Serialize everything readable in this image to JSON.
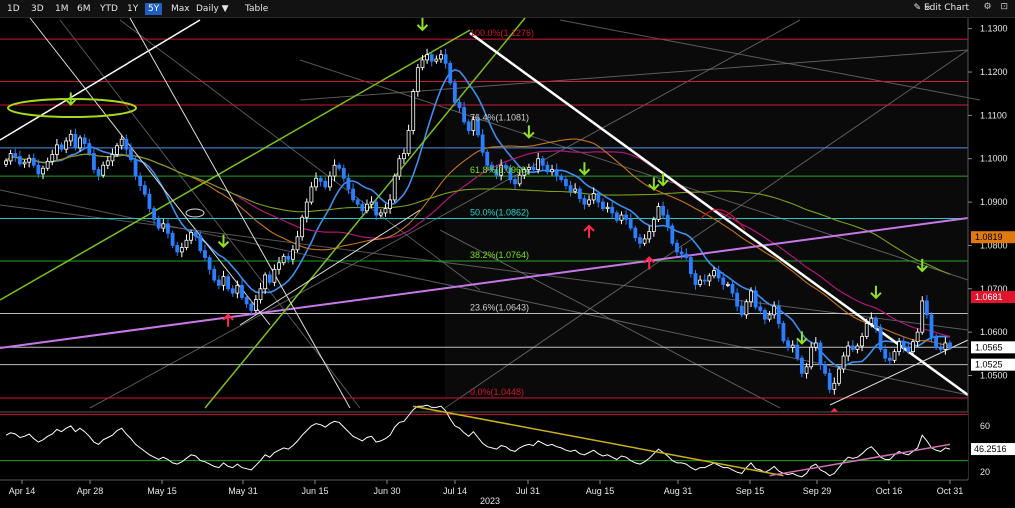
{
  "toolbar": {
    "ranges": [
      "1D",
      "3D",
      "1M",
      "6M",
      "YTD",
      "1Y",
      "5Y",
      "Max"
    ],
    "active_range": "5Y",
    "period": "Daily ▼",
    "table": "Table",
    "edit_chart": "✎ Edit Chart",
    "collapse_icon": "«",
    "icons": "⚙ ⊡"
  },
  "chart_data": {
    "type": "candlestick",
    "year_label": "2023",
    "x_ticks": [
      "Apr 14",
      "Apr 28",
      "May 15",
      "May 31",
      "Jun 15",
      "Jun 30",
      "Jul 14",
      "Jul 31",
      "Aug 15",
      "Aug 31",
      "Sep 15",
      "Sep 29",
      "Oct 16",
      "Oct 31"
    ],
    "y_ticks": [
      "1.1300",
      "1.1200",
      "1.1100",
      "1.1000",
      "1.0900",
      "1.0800",
      "1.0700",
      "1.0600",
      "1.0500"
    ],
    "ylim": [
      1.0425,
      1.132
    ],
    "close_series": [
      1.0995,
      1.1012,
      1.1005,
      1.0988,
      1.0992,
      1.1001,
      1.0985,
      1.0965,
      1.0978,
      1.0994,
      1.101,
      1.1032,
      1.1022,
      1.1041,
      1.1056,
      1.1025,
      1.1048,
      1.1035,
      1.1012,
      1.0975,
      1.0962,
      1.0985,
      1.0995,
      1.101,
      1.103,
      1.1045,
      1.1022,
      1.0998,
      1.096,
      1.0938,
      1.0918,
      1.0885,
      1.086,
      1.084,
      1.085,
      1.0828,
      1.08,
      1.0785,
      1.0795,
      1.0812,
      1.083,
      1.0822,
      1.0788,
      1.0772,
      1.0745,
      1.072,
      1.0708,
      1.0728,
      1.07,
      1.069,
      1.0708,
      1.068,
      1.0665,
      1.065,
      1.0675,
      1.07,
      1.0732,
      1.0715,
      1.0745,
      1.076,
      1.0775,
      1.0768,
      1.079,
      1.082,
      1.0865,
      1.09,
      1.0935,
      1.0955,
      1.0948,
      1.0935,
      1.096,
      1.0985,
      1.0978,
      1.0955,
      1.093,
      1.0905,
      1.0895,
      1.088,
      1.0895,
      1.09,
      1.087,
      1.0875,
      1.0885,
      1.0905,
      1.096,
      1.1,
      1.1012,
      1.1065,
      1.1155,
      1.121,
      1.1228,
      1.124,
      1.1225,
      1.123,
      1.124,
      1.122,
      1.1175,
      1.113,
      1.1118,
      1.1085,
      1.1065,
      1.109,
      1.1055,
      1.1015,
      1.0985,
      1.0975,
      1.0962,
      1.0985,
      1.0978,
      1.0952,
      1.0942,
      1.0962,
      1.0975,
      1.098,
      1.0975,
      1.1,
      1.0985,
      1.097,
      1.0975,
      1.096,
      1.0952,
      1.0938,
      1.0925,
      1.093,
      1.0908,
      1.0895,
      1.0905,
      1.092,
      1.09,
      1.0885,
      1.0888,
      1.0875,
      1.0858,
      1.087,
      1.086,
      1.084,
      1.0818,
      1.0805,
      1.0815,
      1.0832,
      1.086,
      1.089,
      1.087,
      1.0845,
      1.0805,
      1.0785,
      1.078,
      1.0772,
      1.0735,
      1.071,
      1.072,
      1.0718,
      1.073,
      1.0742,
      1.0725,
      1.071,
      1.071,
      1.069,
      1.066,
      1.064,
      1.067,
      1.0695,
      1.0658,
      1.065,
      1.063,
      1.064,
      1.066,
      1.062,
      1.058,
      1.0565,
      1.057,
      1.054,
      1.0505,
      1.052,
      1.0565,
      1.0575,
      1.0525,
      1.0505,
      1.0468,
      1.0482,
      1.0515,
      1.0545,
      1.0568,
      1.056,
      1.0568,
      1.059,
      1.062,
      1.0632,
      1.061,
      1.056,
      1.054,
      1.0535,
      1.0555,
      1.0578,
      1.0565,
      1.0555,
      1.0578,
      1.06,
      1.0672,
      1.064,
      1.0588,
      1.0565,
      1.056,
      1.0575,
      1.0565
    ],
    "last_price": "1.0565",
    "price_labels": [
      "1.0819",
      "1.0681",
      "1.0565",
      "1.0525"
    ],
    "fib_levels": [
      {
        "label": "100.0%(1.1276)",
        "value": 1.1276
      },
      {
        "label": "76.4%(1.1081)",
        "value": 1.1081
      },
      {
        "label": "61.8%(1.0960)",
        "value": 1.096
      },
      {
        "label": "50.0%(1.0862)",
        "value": 1.0862
      },
      {
        "label": "38.2%(1.0764)",
        "value": 1.0764
      },
      {
        "label": "23.6%(1.0643)",
        "value": 1.0643
      },
      {
        "label": "0.0%(1.0448)",
        "value": 1.0448
      }
    ],
    "horizontal_levels": [
      1.1276,
      1.1178,
      1.1124,
      1.1025,
      1.096,
      1.0862,
      1.0764,
      1.0643,
      1.0565,
      1.0525,
      1.0448
    ],
    "rsi": {
      "y_ticks": [
        "60",
        "40",
        "20"
      ],
      "ylim": [
        15,
        72
      ],
      "last": "46.2516",
      "values": [
        52,
        54,
        53,
        50,
        51,
        53,
        49,
        46,
        48,
        51,
        53,
        57,
        55,
        58,
        60,
        55,
        58,
        55,
        51,
        46,
        44,
        48,
        50,
        52,
        56,
        58,
        53,
        49,
        44,
        41,
        38,
        35,
        33,
        31,
        33,
        31,
        28,
        27,
        29,
        32,
        35,
        34,
        30,
        29,
        27,
        25,
        24,
        28,
        25,
        24,
        27,
        24,
        23,
        22,
        26,
        30,
        35,
        33,
        37,
        39,
        41,
        40,
        43,
        47,
        52,
        56,
        60,
        62,
        61,
        59,
        62,
        64,
        63,
        59,
        55,
        51,
        49,
        47,
        50,
        51,
        46,
        47,
        49,
        52,
        59,
        63,
        64,
        69,
        74,
        77,
        77,
        78,
        76,
        76,
        77,
        73,
        66,
        60,
        58,
        54,
        51,
        55,
        50,
        45,
        42,
        41,
        40,
        43,
        42,
        39,
        38,
        41,
        43,
        44,
        43,
        47,
        45,
        43,
        44,
        42,
        41,
        39,
        38,
        39,
        36,
        35,
        37,
        39,
        36,
        34,
        35,
        33,
        31,
        34,
        33,
        30,
        28,
        27,
        29,
        32,
        36,
        40,
        37,
        34,
        30,
        28,
        28,
        27,
        24,
        22,
        24,
        24,
        26,
        28,
        26,
        24,
        24,
        22,
        20,
        19,
        24,
        28,
        23,
        22,
        20,
        22,
        25,
        21,
        19,
        18,
        19,
        17,
        16,
        19,
        25,
        27,
        22,
        20,
        17,
        19,
        24,
        29,
        33,
        32,
        33,
        36,
        40,
        42,
        38,
        33,
        31,
        31,
        35,
        38,
        36,
        35,
        38,
        41,
        52,
        47,
        41,
        39,
        38,
        41,
        40
      ]
    },
    "annotation_arrows": {
      "green_down_index": [
        14,
        47,
        90,
        142,
        113,
        125,
        140,
        172,
        188,
        198
      ],
      "red_up_index": [
        48,
        126,
        139,
        179
      ]
    }
  }
}
